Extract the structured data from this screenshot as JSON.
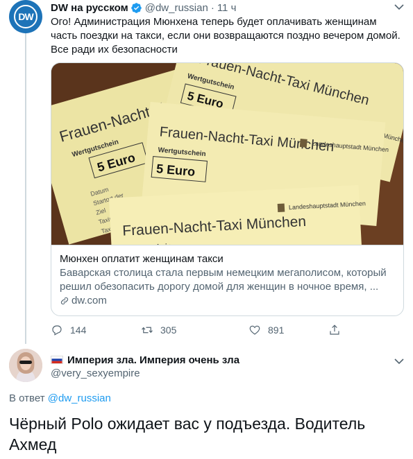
{
  "parent_tweet": {
    "author_name": "DW на русском",
    "avatar_text": "DW",
    "handle": "@dw_russian",
    "separator": "·",
    "time": "11 ч",
    "text": "Ого! Администрация Мюнхена теперь будет оплачивать женщинам часть поездки на такси, если они возвращаются поздно вечером домой. Все ради их безопасности",
    "card": {
      "image_texts": {
        "ticket_title": "Frauen-Nacht-Taxi München",
        "voucher": "Wertgutschein",
        "amount": "5 Euro",
        "issuer": "Landeshauptstadt München",
        "datum": "Datum",
        "startort": "Startort der",
        "ziel": "Ziel",
        "taxi": "Taxiu",
        "taxi_nr": "Taxi-N"
      },
      "title": "Мюнхен оплатит женщинам такси",
      "description": "Баварская столица стала первым немецким мегаполисом, который решил обезопасить дорогу домой для женщин в ночное время, ...",
      "domain": "dw.com"
    },
    "actions": {
      "replies": "144",
      "retweets": "305",
      "likes": "891"
    },
    "colors": {
      "brand": "#1d73b8",
      "verified": "#1d9bf0",
      "secondary_text": "#536471"
    }
  },
  "reply_tweet": {
    "author_name": "Империя зла. Империя очень зла",
    "handle": "@very_sexyempire",
    "in_reply_prefix": "В ответ",
    "in_reply_mention": "@dw_russian",
    "text": "Чёрный Polo ожидает вас у подъезда. Водитель Ахмед"
  },
  "icons": [
    "verified-icon",
    "caret-down-icon",
    "reply-icon",
    "retweet-icon",
    "like-icon",
    "share-icon",
    "link-icon",
    "russian-flag-icon"
  ]
}
